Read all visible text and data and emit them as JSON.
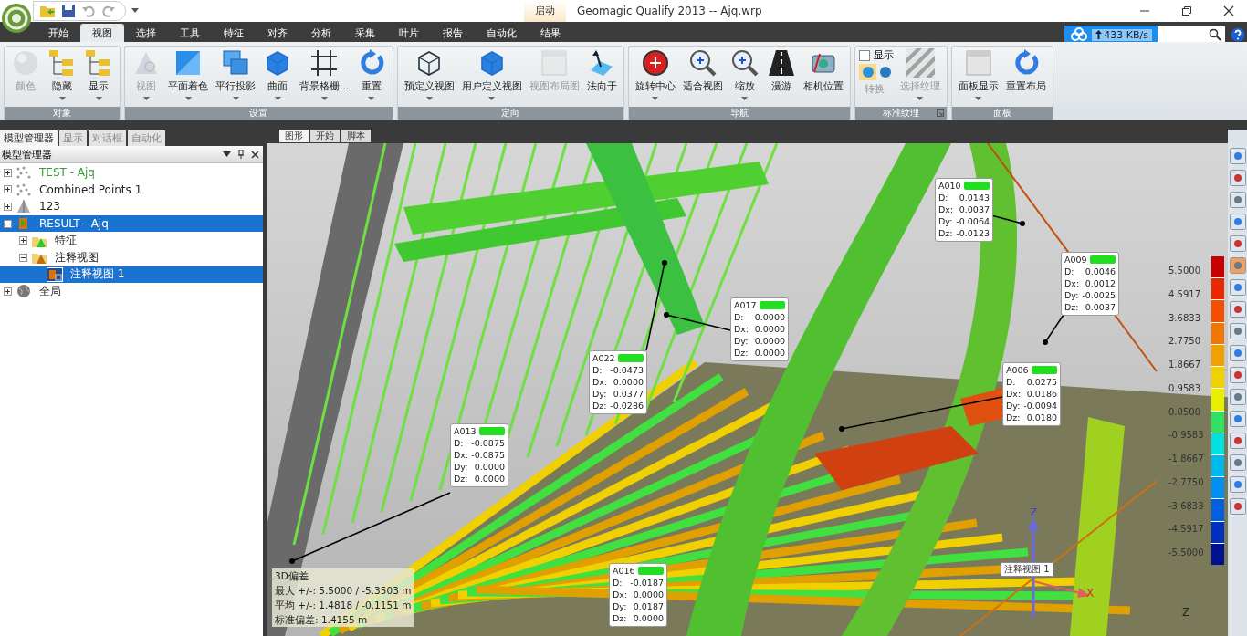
{
  "window": {
    "title": "Geomagic Qualify 2013 -- Ajq.wrp",
    "context_tab": "启动"
  },
  "ribbon_tabs": [
    {
      "label": "开始",
      "selected": false
    },
    {
      "label": "视图",
      "selected": true
    },
    {
      "label": "选择",
      "selected": false
    },
    {
      "label": "工具",
      "selected": false
    },
    {
      "label": "特征",
      "selected": false
    },
    {
      "label": "对齐",
      "selected": false
    },
    {
      "label": "分析",
      "selected": false
    },
    {
      "label": "采集",
      "selected": false
    },
    {
      "label": "叶片",
      "selected": false
    },
    {
      "label": "报告",
      "selected": false
    },
    {
      "label": "自动化",
      "selected": false
    },
    {
      "label": "结果",
      "selected": false
    }
  ],
  "network_widget": {
    "speed": "433 KB/s"
  },
  "ribbon_groups": [
    {
      "title": "对象",
      "buttons": [
        {
          "label": "颜色",
          "disabled": true,
          "dropdown": false
        },
        {
          "label": "隐藏",
          "disabled": false,
          "dropdown": true
        },
        {
          "label": "显示",
          "disabled": false,
          "dropdown": true
        }
      ]
    },
    {
      "title": "设置",
      "buttons": [
        {
          "label": "视图",
          "disabled": true,
          "dropdown": true
        },
        {
          "label": "平面着色",
          "disabled": false,
          "dropdown": true
        },
        {
          "label": "平行投影",
          "disabled": false,
          "dropdown": true
        },
        {
          "label": "曲面",
          "disabled": false,
          "dropdown": true
        },
        {
          "label": "背景格栅...",
          "disabled": false,
          "dropdown": true
        },
        {
          "label": "重置",
          "disabled": false,
          "dropdown": true
        }
      ]
    },
    {
      "title": "定向",
      "buttons": [
        {
          "label": "预定义视图",
          "disabled": false,
          "dropdown": true
        },
        {
          "label": "用户定义视图",
          "disabled": false,
          "dropdown": true
        },
        {
          "label": "视图布局图",
          "disabled": true,
          "dropdown": false
        },
        {
          "label": "法向于",
          "disabled": false,
          "dropdown": false
        }
      ]
    },
    {
      "title": "导航",
      "buttons": [
        {
          "label": "旋转中心",
          "disabled": false,
          "dropdown": true
        },
        {
          "label": "适合视图",
          "disabled": false,
          "dropdown": false
        },
        {
          "label": "缩放",
          "disabled": false,
          "dropdown": true
        },
        {
          "label": "漫游",
          "disabled": false,
          "dropdown": false
        },
        {
          "label": "相机位置",
          "disabled": false,
          "dropdown": false
        }
      ]
    },
    {
      "title": "标准纹理",
      "checkbox": {
        "label": "显示",
        "checked": false
      },
      "buttons": [
        {
          "label": "转换",
          "disabled": true,
          "dropdown": false
        },
        {
          "label": "选择纹理",
          "disabled": true,
          "dropdown": true
        }
      ]
    },
    {
      "title": "面板",
      "buttons": [
        {
          "label": "面板显示",
          "disabled": false,
          "dropdown": true
        },
        {
          "label": "重置布局",
          "disabled": false,
          "dropdown": false
        }
      ]
    }
  ],
  "panel_tabs": [
    {
      "label": "模型管理器",
      "selected": true
    },
    {
      "label": "显示",
      "selected": false
    },
    {
      "label": "对话框",
      "selected": false
    },
    {
      "label": "自动化",
      "selected": false
    }
  ],
  "model_manager": {
    "title": "模型管理器",
    "tree": [
      {
        "label": "TEST - Ajq",
        "kind": "points",
        "expanded": false,
        "selected": false,
        "active": true
      },
      {
        "label": "Combined Points 1",
        "kind": "points",
        "expanded": false,
        "selected": false,
        "active": false
      },
      {
        "label": "123",
        "kind": "mesh",
        "expanded": false,
        "selected": false,
        "active": false
      },
      {
        "label": "RESULT - Ajq",
        "kind": "result",
        "expanded": true,
        "selected": true,
        "active": false,
        "children": [
          {
            "label": "特征",
            "kind": "features",
            "expanded": false,
            "selected": false,
            "active": false
          },
          {
            "label": "注释视图",
            "kind": "views",
            "expanded": true,
            "selected": false,
            "active": false,
            "children": [
              {
                "label": "注释视图 1",
                "kind": "view",
                "selected": true,
                "active": false
              }
            ]
          }
        ]
      },
      {
        "label": "全局",
        "kind": "global",
        "expanded": false,
        "selected": false,
        "active": false
      }
    ]
  },
  "view_tabs": [
    {
      "label": "图形",
      "selected": true
    },
    {
      "label": "开始",
      "selected": false
    },
    {
      "label": "脚本",
      "selected": false
    }
  ],
  "annotations": [
    {
      "name": "A010",
      "color": "#22dd22",
      "rows": [
        {
          "key": "D:",
          "value": "0.0143"
        },
        {
          "key": "Dx:",
          "value": "0.0037"
        },
        {
          "key": "Dy:",
          "value": "-0.0064"
        },
        {
          "key": "Dz:",
          "value": "-0.0123"
        }
      ]
    },
    {
      "name": "A009",
      "color": "#22dd22",
      "rows": [
        {
          "key": "D:",
          "value": "0.0046"
        },
        {
          "key": "Dx:",
          "value": "0.0012"
        },
        {
          "key": "Dy:",
          "value": "-0.0025"
        },
        {
          "key": "Dz:",
          "value": "-0.0037"
        }
      ]
    },
    {
      "name": "A017",
      "color": "#22dd22",
      "rows": [
        {
          "key": "D:",
          "value": "0.0000"
        },
        {
          "key": "Dx:",
          "value": "0.0000"
        },
        {
          "key": "Dy:",
          "value": "0.0000"
        },
        {
          "key": "Dz:",
          "value": "0.0000"
        }
      ]
    },
    {
      "name": "A022",
      "color": "#22dd22",
      "rows": [
        {
          "key": "D:",
          "value": "-0.0473"
        },
        {
          "key": "Dx:",
          "value": "0.0000"
        },
        {
          "key": "Dy:",
          "value": "0.0377"
        },
        {
          "key": "Dz:",
          "value": "-0.0286"
        }
      ]
    },
    {
      "name": "A006",
      "color": "#22dd22",
      "rows": [
        {
          "key": "D:",
          "value": "0.0275"
        },
        {
          "key": "Dx:",
          "value": "0.0186"
        },
        {
          "key": "Dy:",
          "value": "-0.0094"
        },
        {
          "key": "Dz:",
          "value": "0.0180"
        }
      ]
    },
    {
      "name": "A013",
      "color": "#22dd22",
      "rows": [
        {
          "key": "D:",
          "value": "-0.0875"
        },
        {
          "key": "Dx:",
          "value": "-0.0875"
        },
        {
          "key": "Dy:",
          "value": "0.0000"
        },
        {
          "key": "Dz:",
          "value": "0.0000"
        }
      ]
    },
    {
      "name": "A016",
      "color": "#22dd22",
      "rows": [
        {
          "key": "D:",
          "value": "-0.0187"
        },
        {
          "key": "Dx:",
          "value": "0.0000"
        },
        {
          "key": "Dy:",
          "value": "0.0187"
        },
        {
          "key": "Dz:",
          "value": "0.0000"
        }
      ]
    }
  ],
  "legend": {
    "labels": [
      "5.5000",
      "4.5917",
      "3.6833",
      "2.7750",
      "1.8667",
      "0.9583",
      "0.0500",
      "-0.9583",
      "-1.8667",
      "-2.7750",
      "-3.6833",
      "-4.5917",
      "-5.5000"
    ],
    "segments": [
      {
        "color": "#c80000"
      },
      {
        "color": "#e82800"
      },
      {
        "color": "#f05000"
      },
      {
        "color": "#f07800"
      },
      {
        "color": "#f0a000"
      },
      {
        "color": "#f0d000"
      },
      {
        "color": "#e8f000"
      },
      {
        "color": "#30e060"
      },
      {
        "color": "#00e0e0"
      },
      {
        "color": "#00b8f0"
      },
      {
        "color": "#0090f0"
      },
      {
        "color": "#0060e0"
      },
      {
        "color": "#0030c0"
      },
      {
        "color": "#001090"
      }
    ]
  },
  "statistics": [
    "3D偏差",
    "最大 +/-: 5.5000 / -5.3503 m",
    "平均 +/-: 1.4818 / -0.1151 m",
    "标准偏差: 1.4155 m"
  ],
  "triad": {
    "axis_z": "Z",
    "axis_x": "X",
    "view_label": "注释视图 1",
    "corner_axis": "Z"
  }
}
